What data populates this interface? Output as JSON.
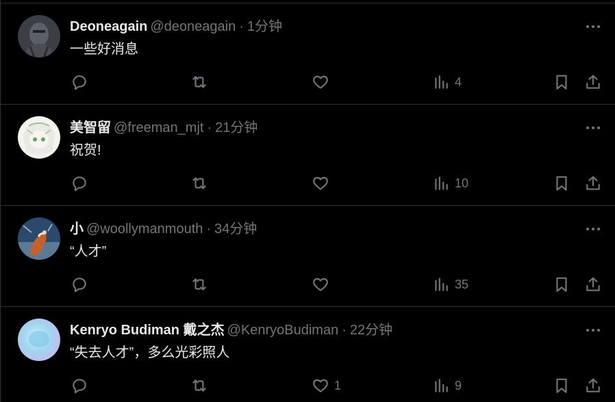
{
  "tweets": [
    {
      "name": "Deoneagain",
      "handle": "@deoneagain",
      "time": "1分钟",
      "text": "一些好消息",
      "reply_count": "",
      "retweet_count": "",
      "like_count": "",
      "view_count": "4"
    },
    {
      "name": "美智留",
      "handle": "@freeman_mjt",
      "time": "21分钟",
      "text": "祝贺!",
      "reply_count": "",
      "retweet_count": "",
      "like_count": "",
      "view_count": "10"
    },
    {
      "name": "小",
      "handle": "@woollymanmouth",
      "time": "34分钟",
      "text": "“人才”",
      "reply_count": "",
      "retweet_count": "",
      "like_count": "",
      "view_count": "35"
    },
    {
      "name": "Kenryo Budiman 戴之杰",
      "handle": "@KenryoBudiman",
      "time": "22分钟",
      "text": "“失去人才”，多么光彩照人",
      "reply_count": "",
      "retweet_count": "",
      "like_count": "1",
      "view_count": "9"
    }
  ],
  "separator": "·",
  "icons": {
    "more": "more-horizontal-icon",
    "reply": "reply-bubble-icon",
    "retweet": "retweet-icon",
    "like": "heart-icon",
    "views": "bar-chart-icon",
    "bookmark": "bookmark-icon",
    "share": "share-upload-icon"
  },
  "colors": {
    "background": "#000000",
    "text_primary": "#e7e9ea",
    "text_secondary": "#71767b",
    "divider": "#2f3336"
  }
}
